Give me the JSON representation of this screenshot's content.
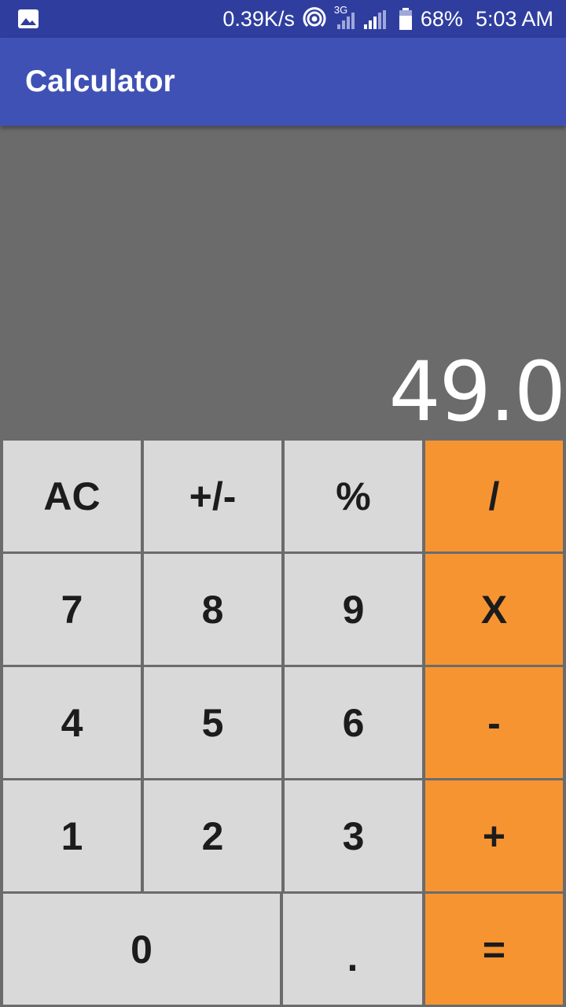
{
  "status_bar": {
    "speed": "0.39K/s",
    "network": "3G",
    "battery": "68%",
    "time": "5:03 AM"
  },
  "app_bar": {
    "title": "Calculator"
  },
  "display": {
    "value": "49.0"
  },
  "keys": {
    "ac": "AC",
    "plus_minus": "+/-",
    "percent": "%",
    "divide": "/",
    "seven": "7",
    "eight": "8",
    "nine": "9",
    "multiply": "X",
    "four": "4",
    "five": "5",
    "six": "6",
    "subtract": "-",
    "one": "1",
    "two": "2",
    "three": "3",
    "add": "+",
    "zero": "0",
    "decimal": ".",
    "equals": "="
  },
  "colors": {
    "status_bar": "#2f3e9e",
    "app_bar": "#3f51b5",
    "display_bg": "#6b6b6b",
    "number_key": "#d9d9d9",
    "operator_key": "#f79432"
  }
}
